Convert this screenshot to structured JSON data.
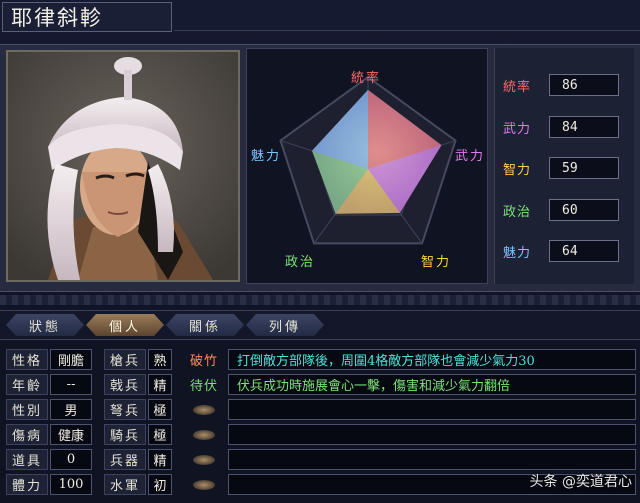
{
  "character": {
    "name": "耶律斜軫"
  },
  "radar": {
    "labels": {
      "top": "統率",
      "right": "武力",
      "bottom_right": "智力",
      "bottom_left": "政治",
      "left": "魅力"
    },
    "values": {
      "統率": 86,
      "武力": 84,
      "智力": 59,
      "政治": 60,
      "魅力": 64
    }
  },
  "stats": [
    {
      "name": "統率",
      "value": "86",
      "color": "#ff6b6b"
    },
    {
      "name": "武力",
      "value": "84",
      "color": "#e07af0"
    },
    {
      "name": "智力",
      "value": "59",
      "color": "#ffd24a"
    },
    {
      "name": "政治",
      "value": "60",
      "color": "#7ee07a"
    },
    {
      "name": "魅力",
      "value": "64",
      "color": "#7ac4ff"
    }
  ],
  "tabs": [
    {
      "label": "狀態",
      "active": false
    },
    {
      "label": "個人",
      "active": true
    },
    {
      "label": "關係",
      "active": false
    },
    {
      "label": "列傳",
      "active": false
    }
  ],
  "personal": [
    {
      "label": "性格",
      "value": "剛膽"
    },
    {
      "label": "年齡",
      "value": "--"
    },
    {
      "label": "性別",
      "value": "男"
    },
    {
      "label": "傷病",
      "value": "健康"
    },
    {
      "label": "道具",
      "value": "0"
    },
    {
      "label": "體力",
      "value": "100"
    }
  ],
  "aptitude": [
    {
      "label": "槍兵",
      "value": "熟"
    },
    {
      "label": "戟兵",
      "value": "精"
    },
    {
      "label": "弩兵",
      "value": "極"
    },
    {
      "label": "騎兵",
      "value": "極"
    },
    {
      "label": "兵器",
      "value": "精"
    },
    {
      "label": "水軍",
      "value": "初"
    }
  ],
  "skills": [
    {
      "name": "破竹",
      "name_color": "#ff8a5a",
      "desc": "打倒敵方部隊後，周圍4格敵方部隊也會減少氣力30"
    },
    {
      "name": "待伏",
      "name_color": "#7ee07a",
      "desc": "伏兵成功時施展會心一擊，傷害和減少氣力翻倍"
    },
    {
      "name": "",
      "desc": ""
    },
    {
      "name": "",
      "desc": ""
    },
    {
      "name": "",
      "desc": ""
    },
    {
      "name": "",
      "desc": ""
    }
  ],
  "watermark": "头条 @奕道君心"
}
